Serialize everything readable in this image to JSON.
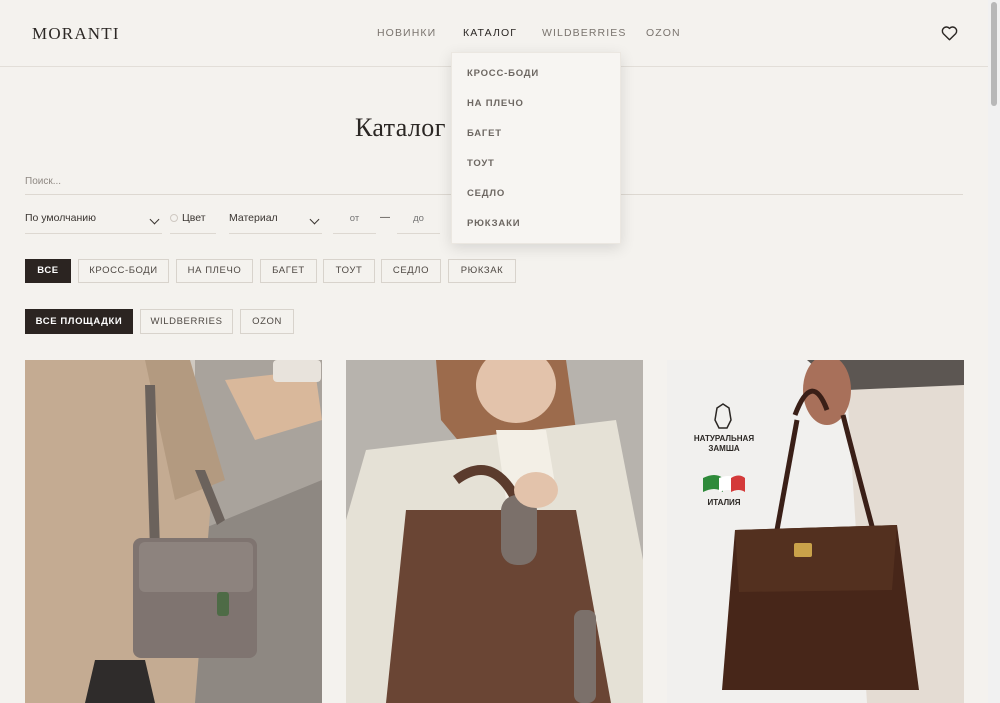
{
  "header": {
    "logo": "MORANTI",
    "nav": [
      {
        "label": "НОВИНКИ",
        "active": false
      },
      {
        "label": "КАТАЛОГ",
        "active": true
      },
      {
        "label": "WILDBERRIES",
        "active": false
      },
      {
        "label": "OZON",
        "active": false
      }
    ],
    "favorites_icon": "heart-icon"
  },
  "catalog_dropdown": {
    "items": [
      "КРОСС-БОДИ",
      "НА ПЛЕЧО",
      "БАГЕТ",
      "ТОУТ",
      "СЕДЛО",
      "РЮКЗАКИ"
    ]
  },
  "page": {
    "title": "Каталог сумок Moranti"
  },
  "search": {
    "placeholder": "Поиск..."
  },
  "filters": {
    "sort_label": "По умолчанию",
    "color_label": "Цвет",
    "material_label": "Материал",
    "price_from_placeholder": "от",
    "price_to_placeholder": "до",
    "price_separator": "—"
  },
  "category_chips": [
    {
      "label": "ВСЕ",
      "active": true
    },
    {
      "label": "КРОСС-БОДИ",
      "active": false
    },
    {
      "label": "НА ПЛЕЧО",
      "active": false
    },
    {
      "label": "БАГЕТ",
      "active": false
    },
    {
      "label": "ТОУТ",
      "active": false
    },
    {
      "label": "СЕДЛО",
      "active": false
    },
    {
      "label": "РЮКЗАК",
      "active": false
    }
  ],
  "platform_chips": [
    {
      "label": "ВСЕ ПЛОЩАДКИ",
      "active": true
    },
    {
      "label": "WILDBERRIES",
      "active": false
    },
    {
      "label": "OZON",
      "active": false
    }
  ],
  "products": [
    {
      "image": "taupe-crossbody-bag-photo"
    },
    {
      "image": "brown-suede-shoulder-bag-photo"
    },
    {
      "image": "dark-brown-suede-satchel-photo",
      "badge_material": "НАТУРАЛЬНАЯ ЗАМША",
      "badge_origin": "ИТАЛИЯ"
    }
  ],
  "colors": {
    "background": "#f4f2ee",
    "text": "#2b2724",
    "active_chip": "#2b2421",
    "border": "#d8d3cc"
  }
}
